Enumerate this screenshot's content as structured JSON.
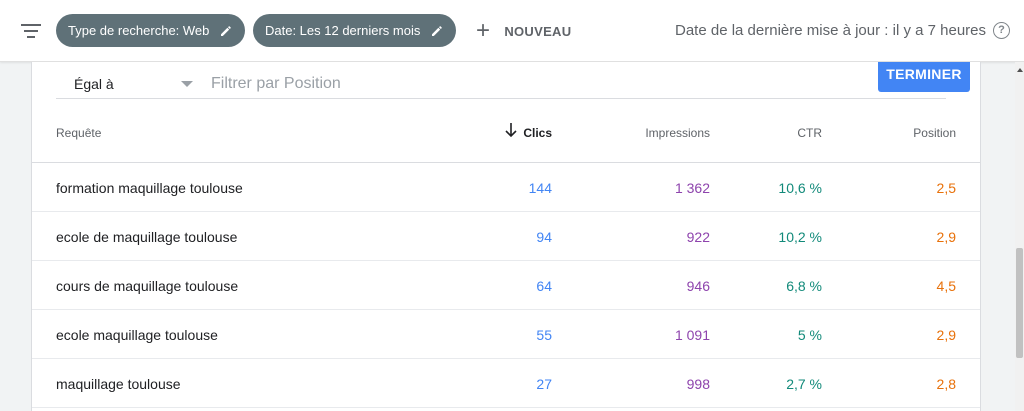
{
  "header": {
    "chips": [
      {
        "label": "Type de recherche: Web"
      },
      {
        "label": "Date: Les 12 derniers mois"
      }
    ],
    "new_label": "NOUVEAU",
    "new_icon": "plus-icon",
    "last_update": "Date de la dernière mise à jour : il y a 7 heures",
    "help_label": "?"
  },
  "filter": {
    "operator": "Égal à",
    "placeholder": "Filtrer par Position",
    "value": "",
    "done_label": "TERMINER"
  },
  "table": {
    "columns": {
      "query": "Requête",
      "clicks": "Clics",
      "impressions": "Impressions",
      "ctr": "CTR",
      "position": "Position"
    },
    "sorted_by": "clicks",
    "sort_direction": "descending",
    "rows": [
      {
        "query": "formation maquillage toulouse",
        "clicks": "144",
        "impressions": "1 362",
        "ctr": "10,6 %",
        "position": "2,5"
      },
      {
        "query": "ecole de maquillage toulouse",
        "clicks": "94",
        "impressions": "922",
        "ctr": "10,2 %",
        "position": "2,9"
      },
      {
        "query": "cours de maquillage toulouse",
        "clicks": "64",
        "impressions": "946",
        "ctr": "6,8 %",
        "position": "4,5"
      },
      {
        "query": "ecole maquillage toulouse",
        "clicks": "55",
        "impressions": "1 091",
        "ctr": "5 %",
        "position": "2,9"
      },
      {
        "query": "maquillage toulouse",
        "clicks": "27",
        "impressions": "998",
        "ctr": "2,7 %",
        "position": "2,8"
      }
    ]
  },
  "colors": {
    "clicks": "#4285f4",
    "impressions": "#8e44ad",
    "ctr": "#128a7a",
    "position": "#e8710a",
    "chip_bg": "#5f7178",
    "button_blue": "#4285f4"
  }
}
